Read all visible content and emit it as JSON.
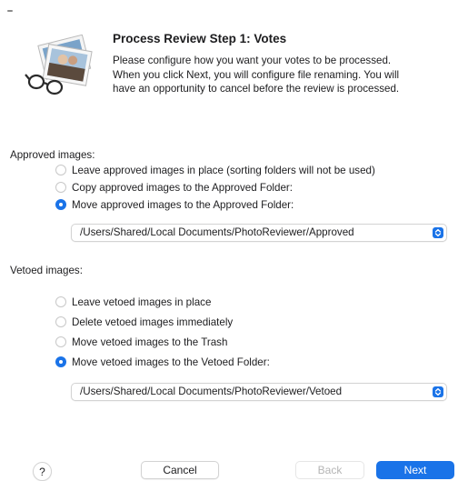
{
  "dialog": {
    "title": "Process Review Step 1: Votes",
    "description_lines": [
      "Please configure how you want your votes to be processed.",
      "When you click Next, you will configure file renaming.  You will",
      "have an opportunity to cancel before the review is processed."
    ]
  },
  "approved": {
    "section_label": "Approved images:",
    "options": [
      {
        "label": "Leave approved images in place (sorting folders will not be used)",
        "selected": false
      },
      {
        "label": "Copy approved images to the Approved Folder:",
        "selected": false
      },
      {
        "label": "Move approved images to the Approved Folder:",
        "selected": true
      }
    ],
    "folder_path": "/Users/Shared/Local Documents/PhotoReviewer/Approved"
  },
  "vetoed": {
    "section_label": "Vetoed images:",
    "options": [
      {
        "label": "Leave vetoed images in place",
        "selected": false
      },
      {
        "label": "Delete vetoed images immediately",
        "selected": false
      },
      {
        "label": "Move vetoed images to the Trash",
        "selected": false
      },
      {
        "label": "Move vetoed images to the Vetoed Folder:",
        "selected": true
      }
    ],
    "folder_path": "/Users/Shared/Local Documents/PhotoReviewer/Vetoed"
  },
  "buttons": {
    "help_label": "?",
    "cancel_label": "Cancel",
    "back_label": "Back",
    "next_label": "Next",
    "back_enabled": false
  },
  "icons": {
    "app_icon": "photos-with-glasses-icon",
    "popup_icon": "up-down-chevron-icon"
  },
  "colors": {
    "accent": "#1a73e8",
    "text": "#1d1d1f",
    "disabled_text": "#b5b5b5"
  }
}
